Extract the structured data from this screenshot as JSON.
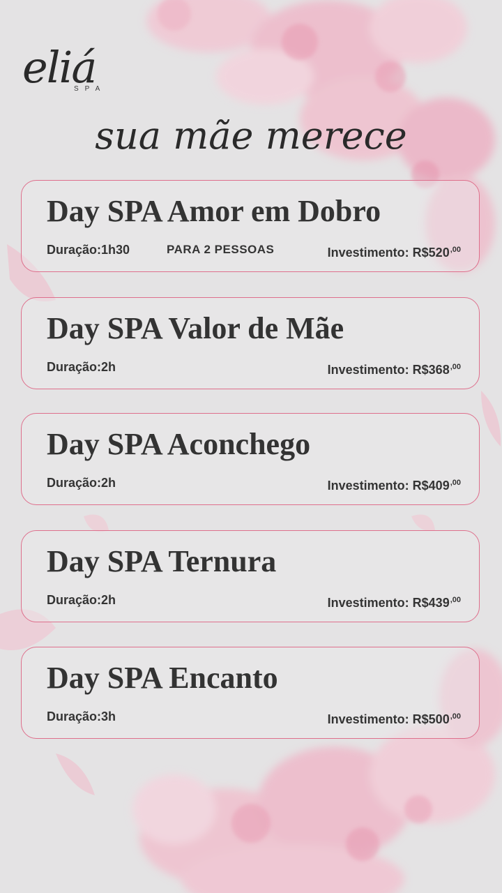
{
  "brand": {
    "logo_text": "eliá",
    "logo_sub": "SPA"
  },
  "headline": "sua mãe merece",
  "packages": [
    {
      "title": "Day SPA Amor em Dobro",
      "duration": "Duração:1h30",
      "extra": "PARA 2 PESSOAS",
      "price": "Investimento: R$520",
      "cents": ",00"
    },
    {
      "title": "Day SPA Valor de Mãe",
      "duration": "Duração:2h",
      "price": "Investimento: R$368",
      "cents": ",00"
    },
    {
      "title": "Day SPA Aconchego",
      "duration": "Duração:2h",
      "price": "Investimento: R$409",
      "cents": ",00"
    },
    {
      "title": "Day SPA Ternura",
      "duration": "Duração:2h",
      "price": "Investimento: R$439",
      "cents": ",00"
    },
    {
      "title": "Day SPA Encanto",
      "duration": "Duração:3h",
      "price": "Investimento: R$500",
      "cents": ",00"
    }
  ],
  "colors": {
    "background": "#e4e3e4",
    "card_border": "#de6f8c",
    "text": "#333333",
    "flower_pink": "#f2b3c6"
  }
}
